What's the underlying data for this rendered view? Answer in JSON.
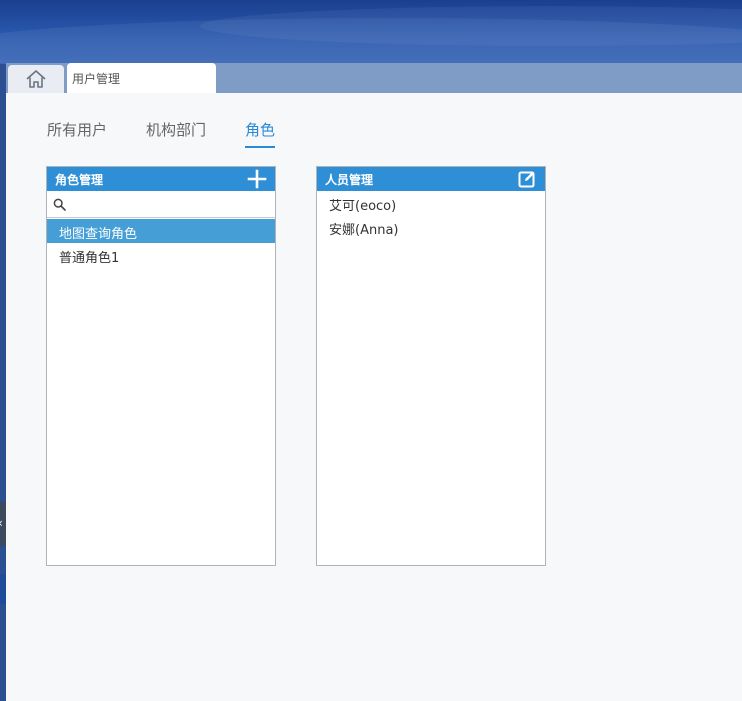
{
  "tabs": {
    "home_icon": "home-icon",
    "page_tab_label": "用户管理"
  },
  "nav": {
    "items": [
      {
        "label": "所有用户"
      },
      {
        "label": "机构部门"
      },
      {
        "label": "角色"
      }
    ],
    "active_index": 2
  },
  "role_panel": {
    "title": "角色管理",
    "add_icon": "plus-icon",
    "search": {
      "value": "",
      "placeholder": ""
    },
    "items": [
      {
        "label": "地图查询角色"
      },
      {
        "label": "普通角色1"
      }
    ],
    "selected_index": 0
  },
  "people_panel": {
    "title": "人员管理",
    "edit_icon": "edit-icon",
    "items": [
      {
        "label": "艾可(eoco)"
      },
      {
        "label": "安娜(Anna)"
      }
    ]
  },
  "colors": {
    "accent": "#2e8fd6",
    "selected_row": "#459fd6",
    "active_tab_text": "#2a8ad8",
    "tabbar": "#7f9cc6"
  }
}
